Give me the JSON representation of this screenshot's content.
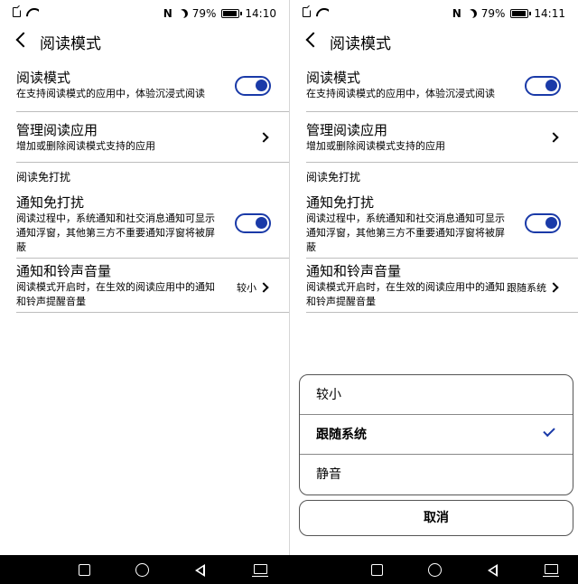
{
  "left": {
    "status": {
      "battery_pct": "79%",
      "time": "14:10",
      "battery_fill": 0.79
    },
    "title": "阅读模式",
    "reading_mode": {
      "title": "阅读模式",
      "desc": "在支持阅读模式的应用中，体验沉浸式阅读",
      "on": true
    },
    "manage_apps": {
      "title": "管理阅读应用",
      "desc": "增加或删除阅读模式支持的应用"
    },
    "section": "阅读免打扰",
    "notify_dnd": {
      "title": "通知免打扰",
      "desc": "阅读过程中，系统通知和社交消息通知可显示通知浮窗，其他第三方不重要通知浮窗将被屏蔽",
      "on": true
    },
    "ring_volume": {
      "title": "通知和铃声音量",
      "desc": "阅读模式开启时，在生效的阅读应用中的通知和铃声提醒音量",
      "value": "较小"
    }
  },
  "right": {
    "status": {
      "battery_pct": "79%",
      "time": "14:11",
      "battery_fill": 0.79
    },
    "title": "阅读模式",
    "reading_mode": {
      "title": "阅读模式",
      "desc": "在支持阅读模式的应用中，体验沉浸式阅读",
      "on": true
    },
    "manage_apps": {
      "title": "管理阅读应用",
      "desc": "增加或删除阅读模式支持的应用"
    },
    "section": "阅读免打扰",
    "notify_dnd": {
      "title": "通知免打扰",
      "desc": "阅读过程中，系统通知和社交消息通知可显示通知浮窗，其他第三方不重要通知浮窗将被屏蔽",
      "on": true
    },
    "ring_volume": {
      "title": "通知和铃声音量",
      "desc": "阅读模式开启时，在生效的阅读应用中的通知和铃声提醒音量",
      "value": "跟随系统"
    },
    "sheet": {
      "options": [
        {
          "label": "较小",
          "selected": false
        },
        {
          "label": "跟随系统",
          "selected": true
        },
        {
          "label": "静音",
          "selected": false
        }
      ],
      "cancel": "取消"
    }
  },
  "colors": {
    "accent": "#1a3aa8",
    "divider": "#bdbdbd",
    "navbar": "#000000"
  },
  "icons": {
    "status": [
      "sim-icon",
      "wifi-icon",
      "nfc-icon",
      "moon-icon",
      "battery-icon"
    ],
    "nav": [
      "square-icon",
      "home-circle-icon",
      "back-triangle-icon",
      "keyboard-icon"
    ]
  }
}
